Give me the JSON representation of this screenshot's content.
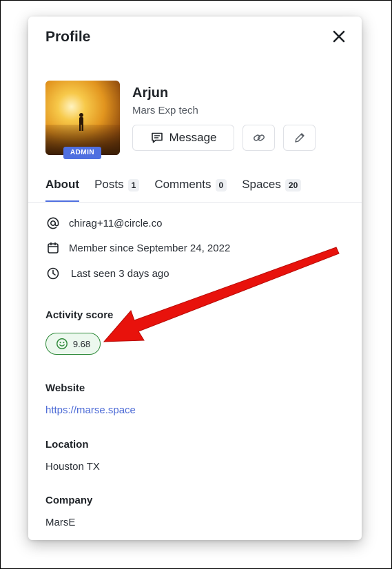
{
  "profile": {
    "title": "Profile",
    "name": "Arjun",
    "subtitle": "Mars Exp tech",
    "admin_badge": "ADMIN"
  },
  "actions": {
    "message_label": "Message",
    "link_icon": "link-icon",
    "edit_icon": "pencil-icon"
  },
  "tabs": [
    {
      "label": "About",
      "count": null,
      "active": true
    },
    {
      "label": "Posts",
      "count": "1",
      "active": false
    },
    {
      "label": "Comments",
      "count": "0",
      "active": false
    },
    {
      "label": "Spaces",
      "count": "20",
      "active": false
    }
  ],
  "about": {
    "email": "chirag+11@circle.co",
    "member_since": "Member since September 24, 2022",
    "last_seen": "Last seen 3 days ago"
  },
  "activity": {
    "label": "Activity score",
    "score": "9.68",
    "icon": "smiley-icon",
    "color": "#2f8a3a"
  },
  "website": {
    "label": "Website",
    "url": "https://marse.space"
  },
  "location": {
    "label": "Location",
    "value": "Houston TX"
  },
  "company": {
    "label": "Company",
    "value": "MarsE"
  },
  "colors": {
    "accent": "#4f6fe0",
    "link": "#4d6bd6",
    "annotation_arrow": "#e8120c"
  }
}
